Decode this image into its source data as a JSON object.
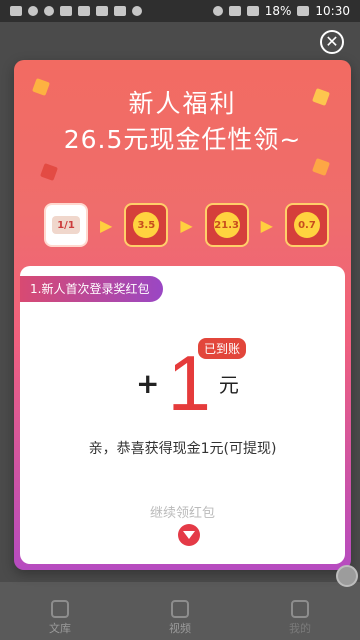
{
  "status_bar": {
    "battery": "18%",
    "time": "10:30"
  },
  "modal": {
    "title_line1": "新人福利",
    "title_line2": "26.5元现金任性领~",
    "steps": [
      {
        "label": "1/1"
      },
      {
        "label": "3.5"
      },
      {
        "label": "21.3"
      },
      {
        "label": "0.7"
      }
    ],
    "card": {
      "tag": "1.新人首次登录奖红包",
      "badge": "已到账",
      "plus": "+",
      "amount": "1",
      "unit": "元",
      "message": "亲，恭喜获得现金1元(可提现)",
      "continue": "继续领红包"
    }
  },
  "bottom_nav": [
    {
      "label": "文库"
    },
    {
      "label": "视频"
    },
    {
      "label": "我的"
    }
  ],
  "colors": {
    "accent_red": "#e53b3b",
    "gradient_top": "#f26b62",
    "gradient_bottom": "#b64bc0",
    "coin_yellow": "#ffd33f"
  }
}
